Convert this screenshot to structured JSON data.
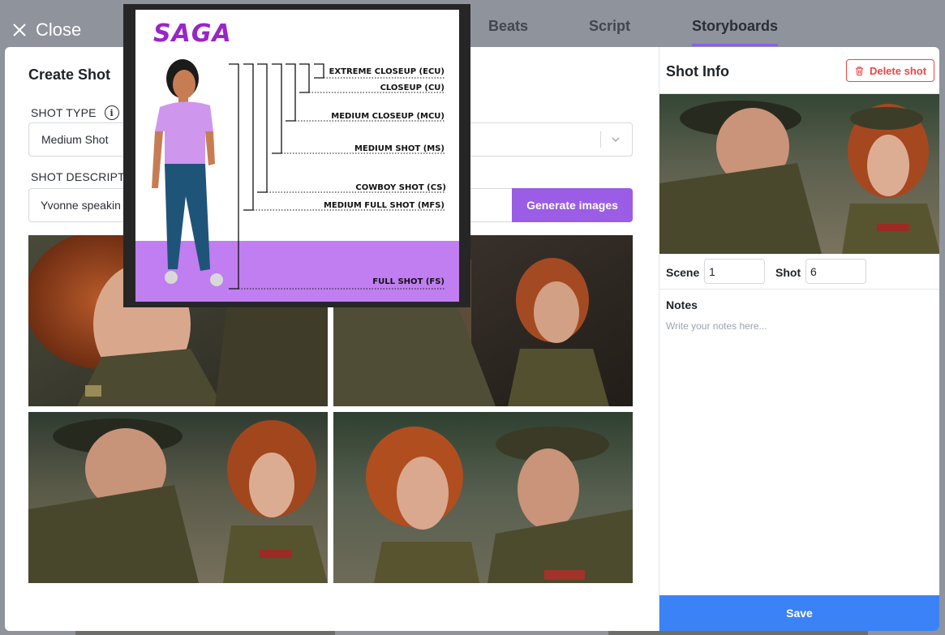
{
  "topbar": {
    "close_label": "Close",
    "tabs": [
      "Beats",
      "Script",
      "Storyboards"
    ],
    "active_tab": "Storyboards",
    "accent_color": "#8b5cf6"
  },
  "create_shot": {
    "title": "Create Shot",
    "shot_type_label": "SHOT TYPE",
    "shot_type_value": "Medium Shot",
    "shot_description_label": "SHOT DESCRIPTIO",
    "shot_description_value": "Yvonne speakin",
    "generate_label": "Generate images",
    "generate_color": "#9b5de5",
    "images": [
      "generated-image-1",
      "generated-image-2",
      "generated-image-3",
      "generated-image-4"
    ]
  },
  "tooltip": {
    "logo": "SAGA",
    "shots": [
      {
        "label": "EXTREME CLOSEUP (ECU)"
      },
      {
        "label": "CLOSEUP (CU)"
      },
      {
        "label": "MEDIUM CLOSEUP (MCU)"
      },
      {
        "label": "MEDIUM SHOT (MS)"
      },
      {
        "label": "COWBOY SHOT (CS)"
      },
      {
        "label": "MEDIUM FULL SHOT (MFS)"
      },
      {
        "label": "FULL SHOT (FS)"
      }
    ]
  },
  "shot_info": {
    "title": "Shot Info",
    "delete_label": "Delete shot",
    "scene_label": "Scene",
    "scene_value": "1",
    "shot_label": "Shot",
    "shot_value": "6",
    "notes_label": "Notes",
    "notes_placeholder": "Write your notes here...",
    "save_label": "Save",
    "save_color": "#3b82f6",
    "delete_color": "#ef4444"
  }
}
